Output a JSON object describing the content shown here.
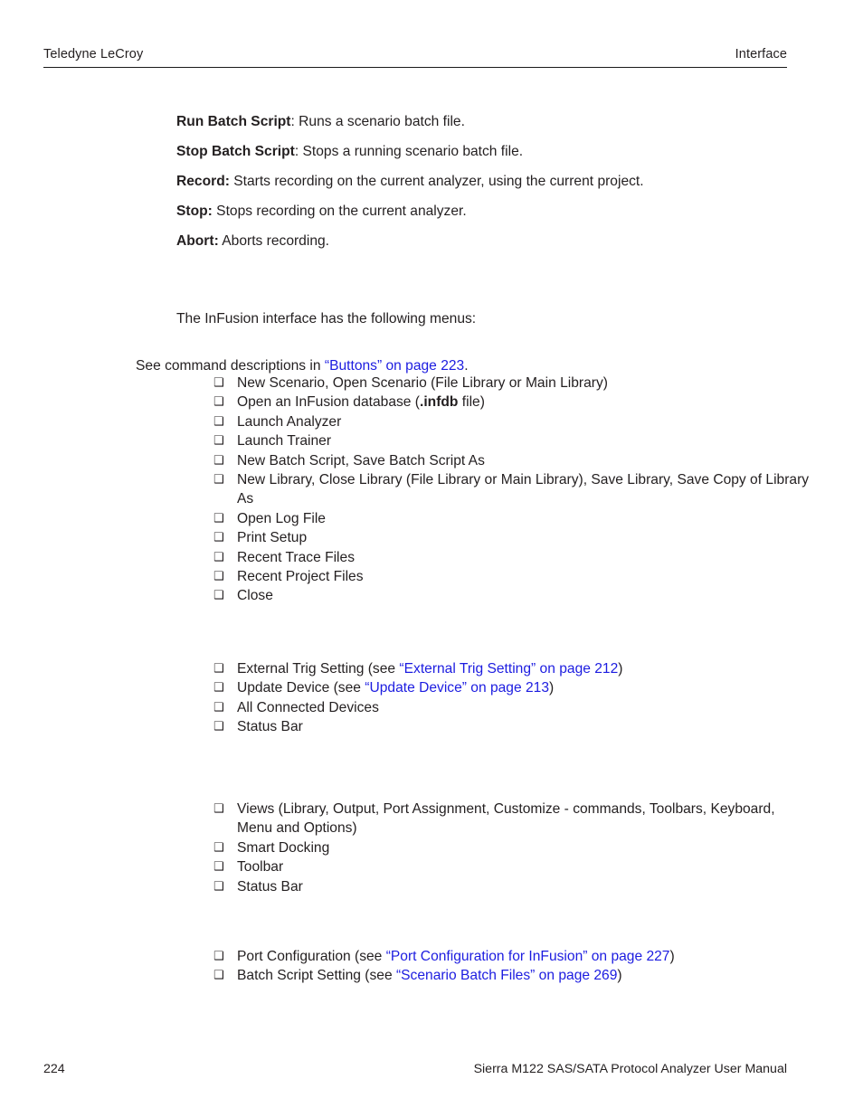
{
  "header": {
    "left": "Teledyne LeCroy",
    "right": "Interface"
  },
  "definitions": [
    {
      "term": "Run Batch Script",
      "term_colon_bold": false,
      "desc": ": Runs a scenario batch file."
    },
    {
      "term": "Stop Batch Script",
      "term_colon_bold": false,
      "desc": ": Stops a running scenario batch file."
    },
    {
      "term": "Record:",
      "term_colon_bold": true,
      "desc": " Starts recording on the current analyzer, using the current project."
    },
    {
      "term": "Stop:",
      "term_colon_bold": true,
      "desc": " Stops recording on the current analyzer."
    },
    {
      "term": "Abort:",
      "term_colon_bold": true,
      "desc": " Aborts recording."
    }
  ],
  "intro": {
    "menus_paragraph": "The InFusion interface has the following menus:",
    "see_prefix": "See command descriptions in ",
    "see_link": "“Buttons” on page 223",
    "see_suffix": "."
  },
  "sections": {
    "file_menu": {
      "items": [
        {
          "pre": "New Scenario, Open Scenario (File Library or Main Library)"
        },
        {
          "pre": "Open an InFusion database (",
          "bold": ".infdb",
          "post": " file)"
        },
        {
          "pre": "Launch Analyzer"
        },
        {
          "pre": "Launch Trainer"
        },
        {
          "pre": "New Batch Script, Save Batch Script As"
        },
        {
          "pre": "New Library, Close Library (File Library or Main Library), Save Library, Save Copy of Library As"
        },
        {
          "pre": "Open Log File"
        },
        {
          "pre": "Print Setup"
        },
        {
          "pre": "Recent Trace Files"
        },
        {
          "pre": "Recent Project Files"
        },
        {
          "pre": "Close"
        }
      ]
    },
    "setup_menu": {
      "items": [
        {
          "pre": "External Trig Setting (see ",
          "link": "“External Trig Setting” on page 212",
          "post": ")"
        },
        {
          "pre": "Update Device (see ",
          "link": "“Update Device” on page 213",
          "post": ")"
        },
        {
          "pre": "All Connected Devices"
        },
        {
          "pre": "Status Bar"
        }
      ]
    },
    "view_menu": {
      "items": [
        {
          "pre": "Views (Library, Output, Port Assignment, Customize - commands, Toolbars, Keyboard, Menu and Options)"
        },
        {
          "pre": "Smart Docking"
        },
        {
          "pre": "Toolbar"
        },
        {
          "pre": "Status Bar"
        }
      ]
    },
    "config_menu": {
      "items": [
        {
          "pre": "Port Configuration (see ",
          "link": "“Port Configuration for InFusion” on page 227",
          "post": ")"
        },
        {
          "pre": "Batch Script Setting (see ",
          "link": "“Scenario Batch Files” on page 269",
          "post": ")"
        }
      ]
    }
  },
  "bullet_glyph": "❑",
  "footer": {
    "page_number": "224",
    "manual_title": "Sierra M122 SAS/SATA Protocol Analyzer User Manual"
  },
  "colors": {
    "link": "#1c1ce0",
    "text": "#231f20"
  }
}
